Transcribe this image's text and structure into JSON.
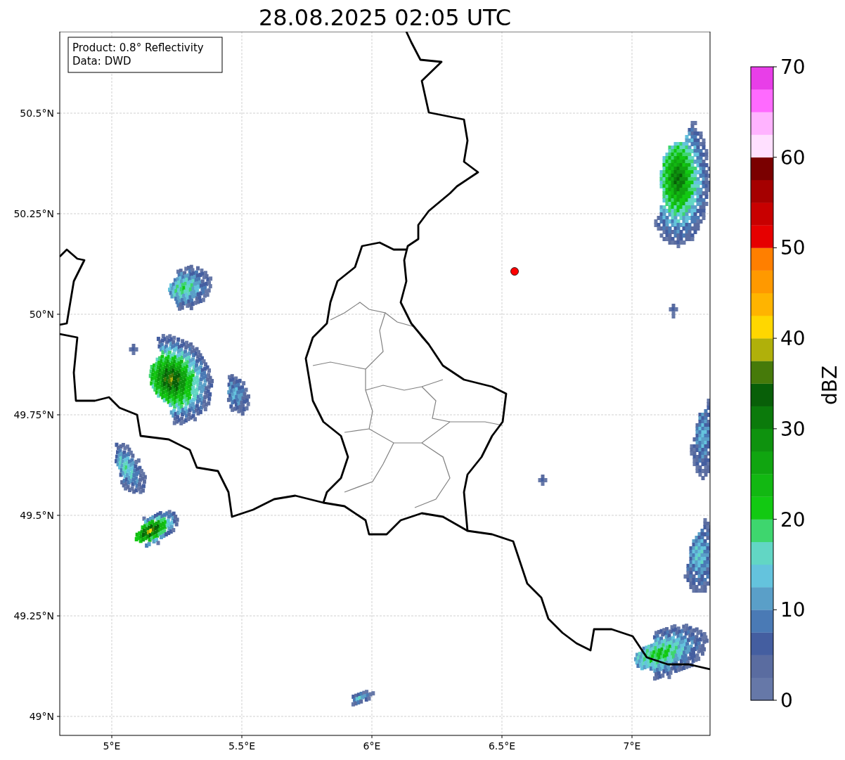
{
  "title": "28.08.2025 02:05 UTC",
  "info_box": {
    "lines": [
      "Product: 0.8° Reflectivity",
      "Data: DWD"
    ]
  },
  "map": {
    "lat_ticks": [
      "50.5°N",
      "50.25°N",
      "50°N",
      "49.75°N",
      "49.5°N",
      "49.25°N",
      "49°N"
    ],
    "lon_ticks": [
      "5°E",
      "5.5°E",
      "6°E",
      "6.5°E",
      "7°E"
    ]
  },
  "colorbar": {
    "label": "dBZ",
    "ticks": [
      "70",
      "60",
      "50",
      "40",
      "30",
      "20",
      "10",
      "0"
    ],
    "segments": [
      {
        "color": "#6678a8"
      },
      {
        "color": "#5a6ca0"
      },
      {
        "color": "#445ea0"
      },
      {
        "color": "#4a7ab5"
      },
      {
        "color": "#5a9fc8"
      },
      {
        "color": "#64c3dd"
      },
      {
        "color": "#62d6c4"
      },
      {
        "color": "#3ed66e"
      },
      {
        "color": "#12c912"
      },
      {
        "color": "#12b812"
      },
      {
        "color": "#10a510"
      },
      {
        "color": "#0e920e"
      },
      {
        "color": "#0b7a0b"
      },
      {
        "color": "#085f08"
      },
      {
        "color": "#467a0a"
      },
      {
        "color": "#b0b00a"
      },
      {
        "color": "#ffd700"
      },
      {
        "color": "#ffb400"
      },
      {
        "color": "#ff9900"
      },
      {
        "color": "#ff7f00"
      },
      {
        "color": "#e60000"
      },
      {
        "color": "#c80000"
      },
      {
        "color": "#a50000"
      },
      {
        "color": "#7a0000"
      },
      {
        "color": "#ffe0ff"
      },
      {
        "color": "#ffb3ff"
      },
      {
        "color": "#ff6aff"
      },
      {
        "color": "#e83ee8"
      }
    ]
  }
}
